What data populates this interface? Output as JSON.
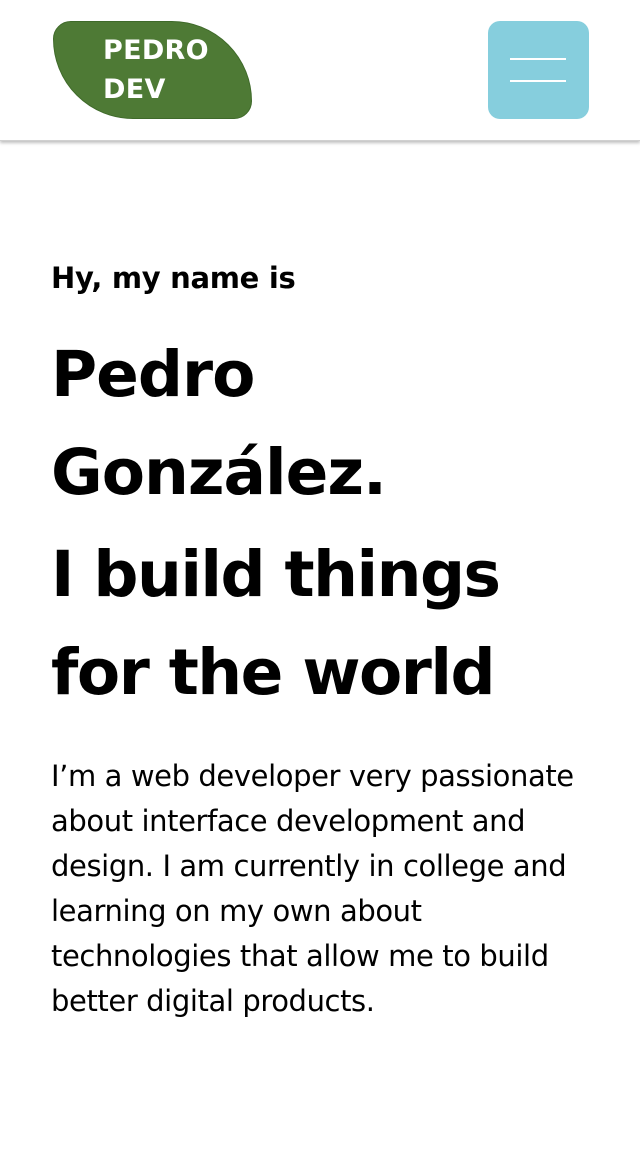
{
  "header": {
    "logo_line1": "PEDRO",
    "logo_line2": "DEV",
    "menu_icon": "hamburger-menu-icon"
  },
  "hero": {
    "greeting": "Hy, my name is",
    "name_line1": "Pedro",
    "name_line2": "González.",
    "tagline_line1": "I build things",
    "tagline_line2": "for the world",
    "intro": "I’m a web developer very passionate about interface development and design. I am currently in college and learning on my own about technologies that allow me to build better digital products."
  },
  "colors": {
    "logo_background": "#4e7a35",
    "menu_button_background": "#86cedd",
    "text": "#000000",
    "background": "#ffffff"
  }
}
